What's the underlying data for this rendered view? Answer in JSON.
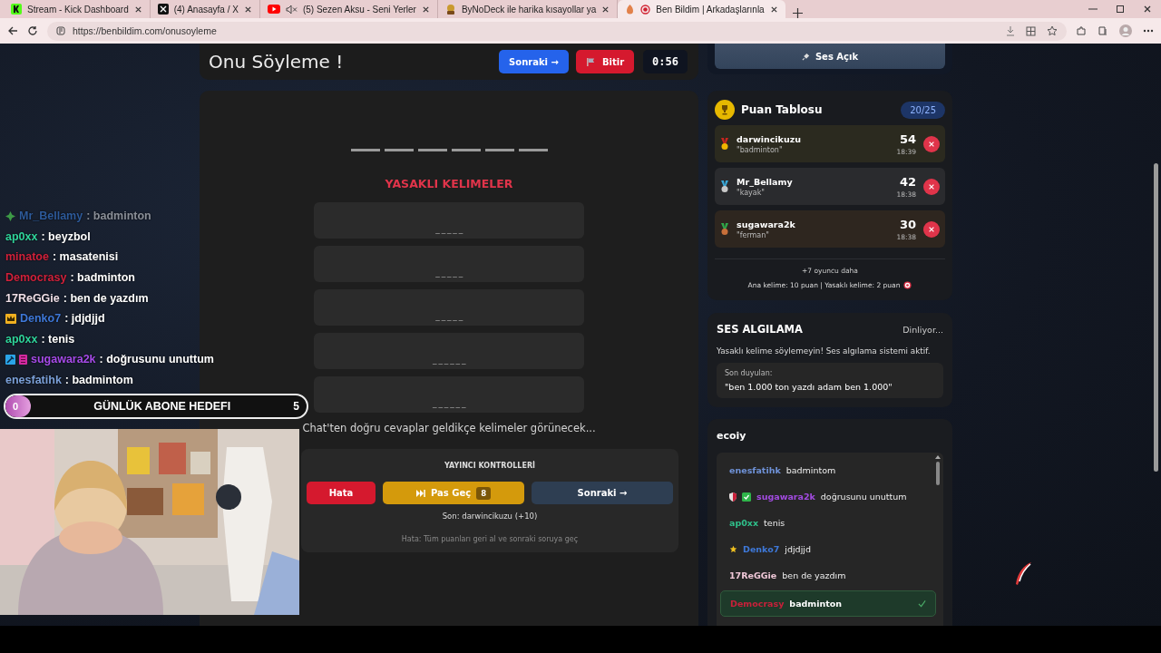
{
  "browser": {
    "tabs": [
      {
        "title": "Stream - Kick Dashboard",
        "kind": "kick",
        "selected": false,
        "muted": false,
        "recording": false
      },
      {
        "title": "(4) Anasayfa / X",
        "kind": "x",
        "selected": false,
        "muted": false,
        "recording": false
      },
      {
        "title": "(5) Sezen Aksu - Seni Yerler",
        "kind": "youtube",
        "selected": false,
        "muted": true,
        "recording": false
      },
      {
        "title": "ByNoDeck ile harika kısayollar ya",
        "kind": "bynodeck",
        "selected": false,
        "muted": false,
        "recording": false
      },
      {
        "title": "Ben Bildim | Arkadaşlarınla",
        "kind": "benbildim",
        "selected": true,
        "muted": false,
        "recording": true
      }
    ],
    "address": "https://benbildim.com/onusoyleme"
  },
  "header": {
    "title": "Onu Söyleme !",
    "next_button": "Sonraki →",
    "finish_button": "Bitir",
    "timer": "0:56"
  },
  "board": {
    "answer_slots": [
      {
        "revealed": false
      },
      {
        "revealed": false
      },
      {
        "revealed": false
      },
      {
        "revealed": false
      },
      {
        "revealed": false
      },
      {
        "revealed": false
      }
    ],
    "forbidden_title": "YASAKLI KELIMELER",
    "forbidden_words": [
      {
        "mask": "_ _ _ _ _"
      },
      {
        "mask": "_ _ _ _ _"
      },
      {
        "mask": "_ _ _ _ _"
      },
      {
        "mask": "_ _ _ _ _ _"
      },
      {
        "mask": "_ _ _ _ _ _"
      }
    ],
    "hint": "Chat'ten doğru cevaplar geldikçe kelimeler görünecek...",
    "controls": {
      "title": "YAYINCI KONTROLLERİ",
      "buttons": [
        {
          "kind": "error",
          "label": "Hata"
        },
        {
          "kind": "skip",
          "label": "Pas Geç",
          "count": "8"
        },
        {
          "kind": "next",
          "label": "Sonraki →"
        }
      ],
      "last": "Son: darwincikuzu (+10)",
      "note": "Hata: Tüm puanları geri al ve sonraki soruya geç"
    }
  },
  "sound_button": "Ses Açık",
  "scoreboard": {
    "title": "Puan Tablosu",
    "count": "20/25",
    "players": [
      {
        "kind": "gold",
        "name": "darwincikuzu",
        "word": "\"badminton\"",
        "score": "54",
        "time": "18:39"
      },
      {
        "kind": "silver",
        "name": "Mr_Bellamy",
        "word": "\"kayak\"",
        "score": "42",
        "time": "18:38"
      },
      {
        "kind": "bronze",
        "name": "sugawara2k",
        "word": "\"ferman\"",
        "score": "30",
        "time": "18:38"
      }
    ],
    "more": "+7 oyuncu daha",
    "rules": "Ana kelime: 10 puan | Yasaklı kelime: 2 puan"
  },
  "voice": {
    "title": "SES ALGILAMA",
    "status": "Dinliyor...",
    "warning": "Yasaklı kelime söylemeyin! Ses algılama sistemi aktif.",
    "last_heard_label": "Son duyulan:",
    "last_heard": "\"ben 1.000 ton yazdı adam ben 1.000\""
  },
  "chat": {
    "channel": "ecoiy",
    "messages": [
      {
        "user": "enesfatihk",
        "color": "#6f92d8",
        "text": "badmintom",
        "correct": false
      },
      {
        "user": "sugawara2k",
        "color": "#a24be0",
        "text": "doğrusunu unuttum",
        "correct": false,
        "badges": [
          {
            "kind": "shield"
          },
          {
            "kind": "check"
          }
        ]
      },
      {
        "user": "ap0xx",
        "color": "#2fbf8a",
        "text": "tenis",
        "correct": false
      },
      {
        "user": "Denko7",
        "color": "#3e78d8",
        "text": "jdjdjjd",
        "correct": false,
        "badges": [
          {
            "kind": "star"
          }
        ]
      },
      {
        "user": "17ReGGie",
        "color": "#f0c8d8",
        "text": "ben de yazdım",
        "correct": false
      },
      {
        "user": "Democrasy",
        "color": "#c8203a",
        "text": "badminton",
        "correct": true
      }
    ]
  },
  "stream_chat": [
    {
      "user": "Mr_Bellamy",
      "color": "#2d5a9a",
      "text": ": badminton",
      "faded": true,
      "badges": [
        {
          "kind": "gem"
        }
      ]
    },
    {
      "user": "ap0xx",
      "color": "#2fd39a",
      "text": ": beyzbol",
      "faded": false
    },
    {
      "user": "minatoe",
      "color": "#d0213b",
      "text": ": masatenisi",
      "faded": false
    },
    {
      "user": "Democrasy",
      "color": "#d0213b",
      "text": ": badminton",
      "faded": false
    },
    {
      "user": "17ReGGie",
      "color": "#f0e0e8",
      "text": ": ben de yazdım",
      "faded": false
    },
    {
      "user": "Denko7",
      "color": "#3e78d8",
      "text": ": jdjdjjd",
      "faded": false,
      "badges": [
        {
          "kind": "crown"
        }
      ]
    },
    {
      "user": "ap0xx",
      "color": "#2fd39a",
      "text": ": tenis",
      "faded": false
    },
    {
      "user": "sugawara2k",
      "color": "#a64be8",
      "text": ": doğrusunu unuttum",
      "faded": false,
      "badges": [
        {
          "kind": "tool"
        },
        {
          "kind": "stripes"
        }
      ]
    },
    {
      "user": "enesfatihk",
      "color": "#7ba0d8",
      "text": ": badmintom",
      "faded": false
    }
  ],
  "goal": {
    "title": "GÜNLÜK ABONE HEDEFI",
    "current": "0",
    "target": "5",
    "level": 0
  }
}
